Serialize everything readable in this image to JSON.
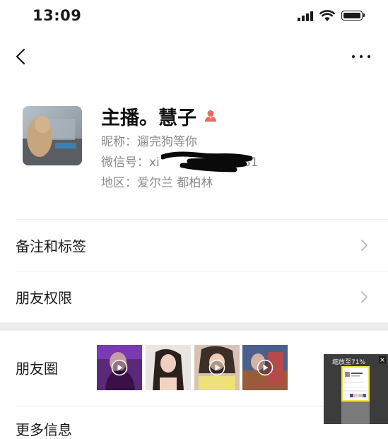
{
  "status_bar": {
    "time": "13:09",
    "icons": [
      "signal-icon",
      "wifi-icon",
      "battery-icon"
    ]
  },
  "nav": {
    "icons": [
      "back-icon",
      "more-icon"
    ]
  },
  "profile": {
    "display_name": "主播。慧子",
    "gender_icon": "female-icon",
    "gender_color": "#e86a60",
    "nickname_line": "昵称：遛完狗等你",
    "wechat_id_line": "微信号：xi",
    "wechat_id_tail": "81",
    "region_line": "地区：爱尔兰 都柏林"
  },
  "menu": {
    "remarks_label": "备注和标签",
    "permissions_label": "朋友权限",
    "moments_label": "朋友圈",
    "next_label": "更多信息"
  },
  "moments_thumbnails": [
    {
      "name": "moment-thumb-1",
      "has_play": true
    },
    {
      "name": "moment-thumb-2",
      "has_play": false
    },
    {
      "name": "moment-thumb-3",
      "has_play": true
    },
    {
      "name": "moment-thumb-4",
      "has_play": true
    }
  ],
  "zoom_overlay": {
    "label": "缩放至71%",
    "zoom_percent": 71
  },
  "colors": {
    "divider": "#ececec",
    "secondary_text": "#8a8a8a",
    "section_gap": "#ededed",
    "chevron": "#b8b8b8"
  }
}
